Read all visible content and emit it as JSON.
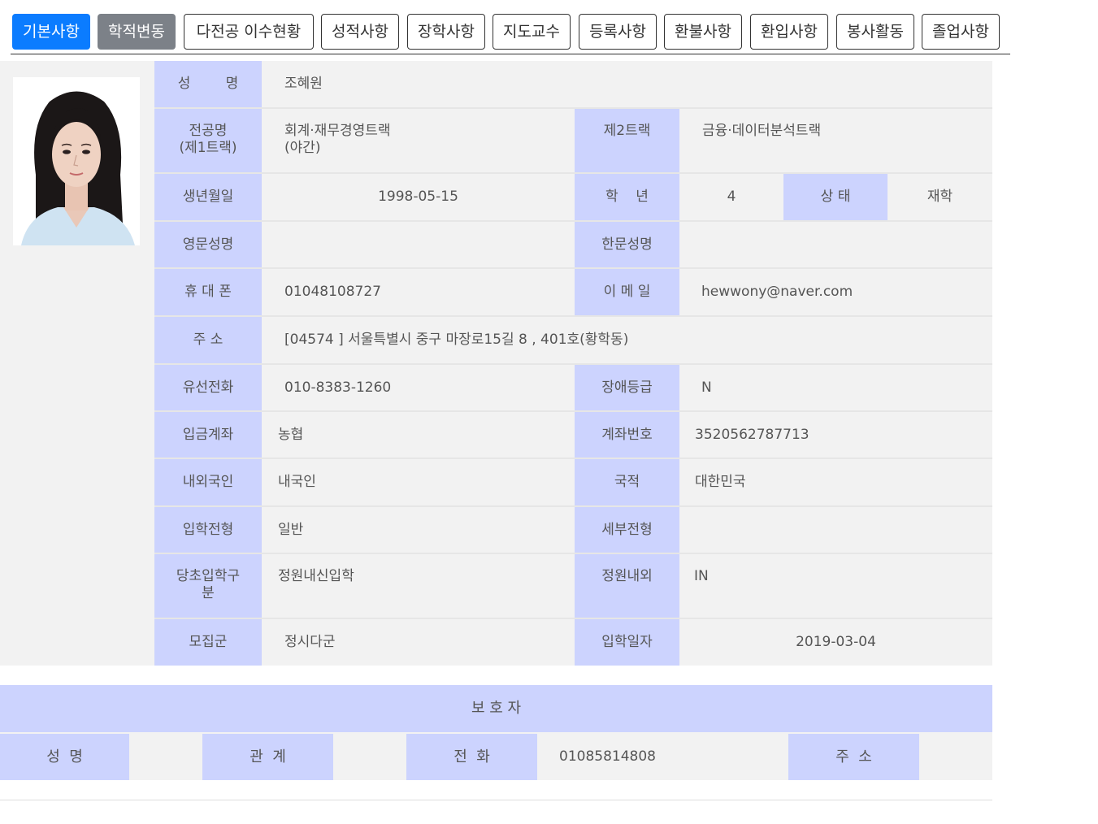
{
  "tabs": [
    "기본사항",
    "학적변동",
    "다전공 이수현황",
    "성적사항",
    "장학사항",
    "지도교수",
    "등록사항",
    "환불사항",
    "환입사항",
    "봉사활동",
    "졸업사항"
  ],
  "student": {
    "photo_alt": "학생 사진",
    "name_label": "성        명",
    "name": "조혜원",
    "major_label_1": "전공명",
    "major_label_2": "(제1트랙)",
    "major_1": "회계·재무경영트랙",
    "major_2": "(야간)",
    "track2_label": "제2트랙",
    "track2": "금융·데이터분석트랙",
    "birth_label": "생년월일",
    "birth": "1998-05-15",
    "grade_label": "학    년",
    "grade": "4",
    "status_label": "상 태",
    "status": "재학",
    "eng_name_label": "영문성명",
    "eng_name": "",
    "hanja_name_label": "한문성명",
    "hanja_name": "",
    "mobile_label": "휴 대 폰",
    "mobile": "01048108727",
    "email_label": "이 메 일",
    "email": "hewwony@naver.com",
    "address_label": "주 소",
    "address": "[04574 ] 서울특별시 중구 마장로15길 8 , 401호(황학동)",
    "phone_label": "유선전화",
    "phone": "010-8383-1260",
    "disability_label": "장애등급",
    "disability": "N",
    "bank_label": "입금계좌",
    "bank": "농협",
    "account_label": "계좌번호",
    "account": "3520562787713",
    "domestic_label": "내외국인",
    "domestic": "내국인",
    "nationality_label": "국적",
    "nationality": "대한민국",
    "admission_type_label": "입학전형",
    "admission_type": "일반",
    "sub_type_label": "세부전형",
    "sub_type": "",
    "initial_label_1": "당초입학구",
    "initial_label_2": "분",
    "initial": "정원내신입학",
    "quota_label": "정원내외",
    "quota": "IN",
    "recruit_label": "모집군",
    "recruit": "정시다군",
    "entry_date_label": "입학일자",
    "entry_date": "2019-03-04"
  },
  "guardian": {
    "title": "보 호 자",
    "name_label": "성  명",
    "name": "",
    "relation_label": "관  계",
    "relation": "",
    "phone_label": "전  화",
    "phone": "01085814808",
    "address_label": "주  소",
    "address": ""
  },
  "colors": {
    "tab_active": "#0b7cff",
    "tab_secondary": "#7c8188",
    "label_bg": "#ccd3fe",
    "value_bg": "#f2f2f2"
  }
}
